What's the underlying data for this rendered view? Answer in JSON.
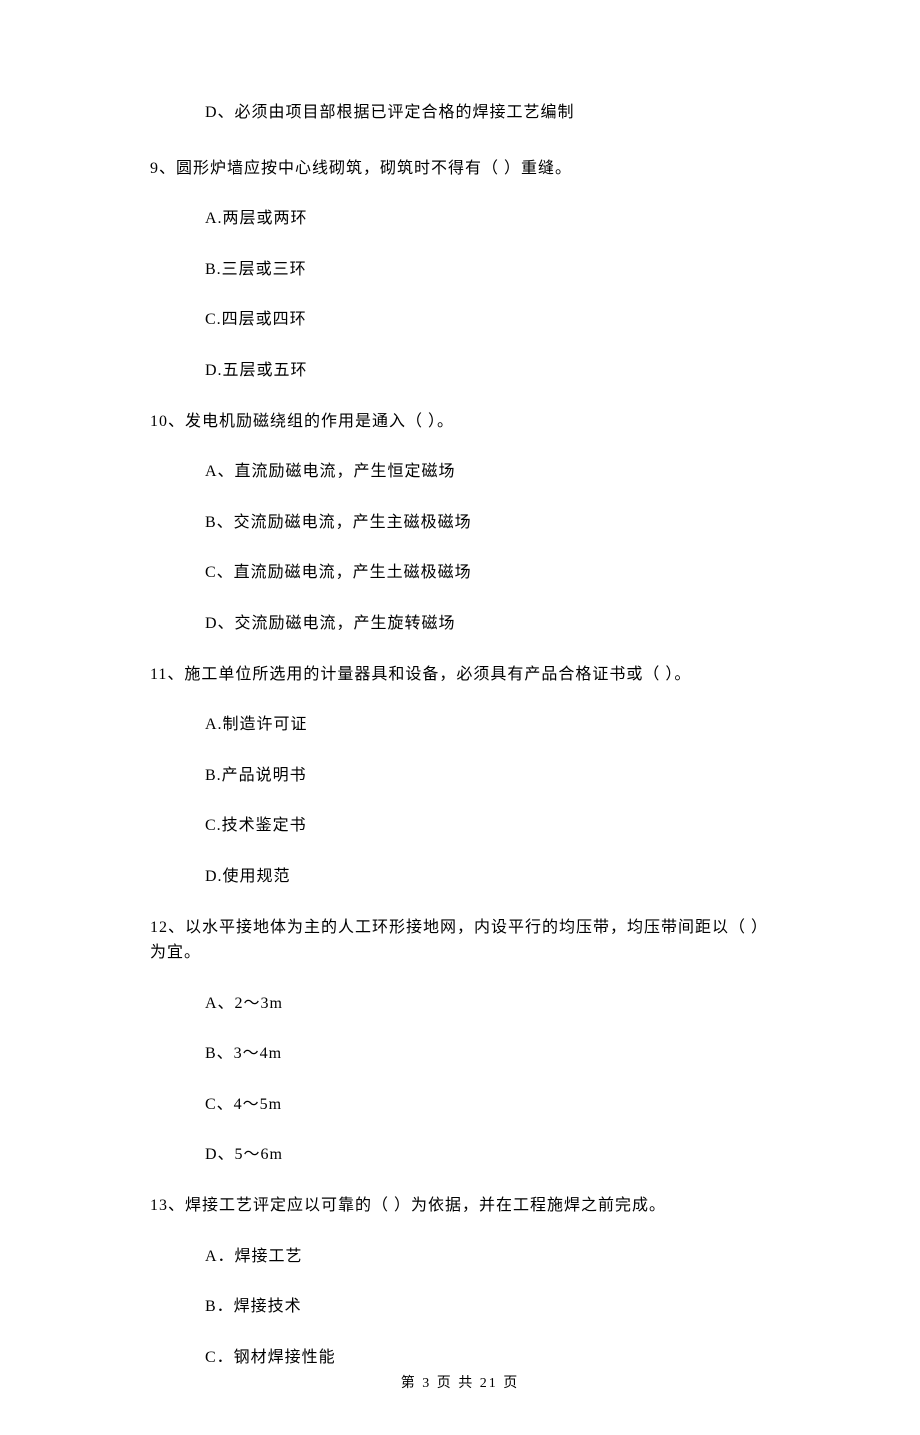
{
  "option_d_first": "D、必须由项目部根据已评定合格的焊接工艺编制",
  "questions": [
    {
      "stem": "9、圆形炉墙应按中心线砌筑，砌筑时不得有（    ）重缝。",
      "options": [
        "A.两层或两环",
        "B.三层或三环",
        "C.四层或四环",
        "D.五层或五环"
      ]
    },
    {
      "stem": "10、发电机励磁绕组的作用是通入（    ）。",
      "options": [
        "A、直流励磁电流，产生恒定磁场",
        "B、交流励磁电流，产生主磁极磁场",
        "C、直流励磁电流，产生土磁极磁场",
        "D、交流励磁电流，产生旋转磁场"
      ]
    },
    {
      "stem": "11、施工单位所选用的计量器具和设备，必须具有产品合格证书或（    ）。",
      "options": [
        "A.制造许可证",
        "B.产品说明书",
        "C.技术鉴定书",
        "D.使用规范"
      ]
    },
    {
      "stem": "12、以水平接地体为主的人工环形接地网，内设平行的均压带，均压带间距以（    ）为宜。",
      "options": [
        "A、2～3m",
        "B、3～4m",
        "C、4～5m",
        "D、5～6m"
      ]
    },
    {
      "stem": "13、焊接工艺评定应以可靠的（    ）为依据，并在工程施焊之前完成。",
      "options": [
        "A．焊接工艺",
        "B．焊接技术",
        "C．钢材焊接性能"
      ]
    }
  ],
  "footer": "第 3 页 共 21 页"
}
